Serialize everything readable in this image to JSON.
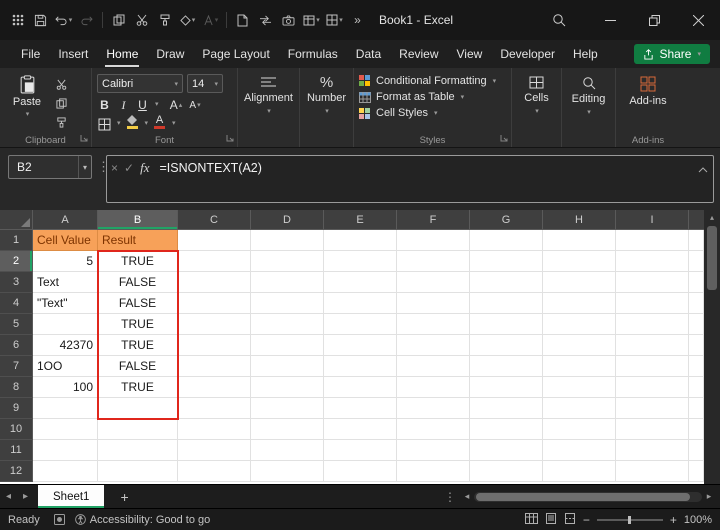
{
  "window": {
    "title": "Book1 - Excel"
  },
  "menu": {
    "tabs": [
      "File",
      "Insert",
      "Home",
      "Draw",
      "Page Layout",
      "Formulas",
      "Data",
      "Review",
      "View",
      "Developer",
      "Help"
    ],
    "active_tab": "Home",
    "share": "Share"
  },
  "ribbon": {
    "paste": "Paste",
    "clipboard": "Clipboard",
    "font_name": "Calibri",
    "font_size": "14",
    "font": "Font",
    "alignment": "Alignment",
    "number": "Number",
    "conditional": "Conditional Formatting",
    "format_table": "Format as Table",
    "cell_styles": "Cell Styles",
    "styles": "Styles",
    "cells": "Cells",
    "editing": "Editing",
    "addins": "Add-ins"
  },
  "formula_bar": {
    "name_box": "B2",
    "fx": "fx",
    "formula": "=ISNONTEXT(A2)"
  },
  "grid": {
    "columns": [
      "A",
      "B",
      "C",
      "D",
      "E",
      "F",
      "G",
      "H",
      "I"
    ],
    "rows": [
      {
        "n": "1",
        "A": "Cell Value",
        "B": "Result"
      },
      {
        "n": "2",
        "A": "5",
        "B": "TRUE"
      },
      {
        "n": "3",
        "A": "Text",
        "B": "FALSE"
      },
      {
        "n": "4",
        "A": "\"Text\"",
        "B": "FALSE"
      },
      {
        "n": "5",
        "A": "",
        "B": "TRUE"
      },
      {
        "n": "6",
        "A": "42370",
        "B": "TRUE"
      },
      {
        "n": "7",
        "A": "1OO",
        "B": "FALSE"
      },
      {
        "n": "8",
        "A": "100",
        "B": "TRUE"
      },
      {
        "n": "9",
        "A": "",
        "B": ""
      },
      {
        "n": "10",
        "A": "",
        "B": ""
      },
      {
        "n": "11",
        "A": "",
        "B": ""
      },
      {
        "n": "12",
        "A": "",
        "B": ""
      }
    ]
  },
  "sheet_bar": {
    "active_sheet": "Sheet1",
    "add_label": "+"
  },
  "status": {
    "ready": "Ready",
    "accessibility": "Accessibility: Good to go",
    "zoom": "100%"
  },
  "colors": {
    "excel_green": "#107C41",
    "header_fill": "#F7A159",
    "header_text": "#7D3300",
    "highlight_border": "#E0261C"
  }
}
